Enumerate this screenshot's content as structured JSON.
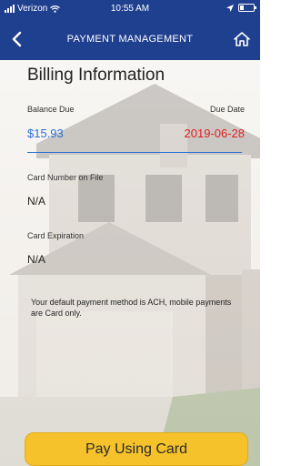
{
  "status_bar": {
    "carrier": "Verizon",
    "time": "10:55 AM"
  },
  "nav": {
    "title": "PAYMENT MANAGEMENT"
  },
  "billing": {
    "heading": "Billing Information",
    "balance_label": "Balance Due",
    "balance_value": "$15.93",
    "due_label": "Due Date",
    "due_value": "2019-06-28"
  },
  "card": {
    "number_label": "Card Number on File",
    "number_value": "N/A",
    "expiration_label": "Card Expiration",
    "expiration_value": "N/A"
  },
  "note": "Your default payment method is ACH, mobile payments are Card only.",
  "pay_button": {
    "label": "Pay Using Card"
  },
  "colors": {
    "header": "#1f3f8f",
    "balance": "#2a6fd6",
    "due_date": "#e02020",
    "button": "#f6c22c"
  }
}
